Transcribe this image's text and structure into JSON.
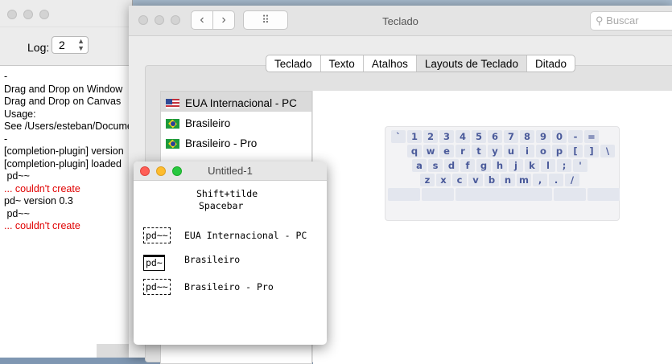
{
  "pd_window": {
    "log_label": "Log:",
    "log_value": "2",
    "console": [
      {
        "text": "-",
        "color": "black"
      },
      {
        "text": "Drag and Drop on Window",
        "color": "black"
      },
      {
        "text": "Drag and Drop on Canvas",
        "color": "black"
      },
      {
        "text": "Usage:",
        "color": "black"
      },
      {
        "text": "See /Users/esteban/Documents",
        "color": "black"
      },
      {
        "text": "-",
        "color": "black"
      },
      {
        "text": "[completion-plugin] version",
        "color": "black"
      },
      {
        "text": "[completion-plugin] loaded",
        "color": "black"
      },
      {
        "text": " pd~~",
        "color": "black"
      },
      {
        "text": "... couldn't create",
        "color": "red"
      },
      {
        "text": "pd~ version 0.3",
        "color": "black"
      },
      {
        "text": " pd~~",
        "color": "black"
      },
      {
        "text": "... couldn't create",
        "color": "red"
      }
    ]
  },
  "prefs": {
    "title": "Teclado",
    "search_placeholder": "Buscar",
    "back": "‹",
    "forward": "›",
    "grid": "⠿",
    "tabs": [
      "Teclado",
      "Texto",
      "Atalhos",
      "Layouts de Teclado",
      "Ditado"
    ],
    "selected_tab": 3,
    "layouts": [
      {
        "label": "EUA Internacional - PC",
        "flag": "us",
        "selected": true
      },
      {
        "label": "Brasileiro",
        "flag": "br",
        "selected": false
      },
      {
        "label": "Brasileiro - Pro",
        "flag": "br",
        "selected": false
      }
    ],
    "keyboard_rows": [
      [
        "`",
        "1",
        "2",
        "3",
        "4",
        "5",
        "6",
        "7",
        "8",
        "9",
        "0",
        "-",
        "="
      ],
      [
        "q",
        "w",
        "e",
        "r",
        "t",
        "y",
        "u",
        "i",
        "o",
        "p",
        "[",
        "]",
        "\\"
      ],
      [
        "a",
        "s",
        "d",
        "f",
        "g",
        "h",
        "j",
        "k",
        "l",
        ";",
        "'"
      ],
      [
        "z",
        "x",
        "c",
        "v",
        "b",
        "n",
        "m",
        ",",
        ".",
        "/"
      ]
    ]
  },
  "patch": {
    "title": "Untitled-1",
    "comment_line1": "Shift+tilde",
    "comment_line2": "Spacebar",
    "rows": [
      {
        "box": "pd~~",
        "label": "EUA Internacional - PC"
      },
      {
        "box": "pd~",
        "label": "Brasileiro"
      },
      {
        "box": "pd~~",
        "label": "Brasileiro - Pro"
      }
    ]
  },
  "colors": {
    "accent_blue": "#4a5a9a",
    "error_red": "#e00000",
    "close": "#ff5f57",
    "minimize": "#febc2e",
    "zoom": "#28c840"
  }
}
